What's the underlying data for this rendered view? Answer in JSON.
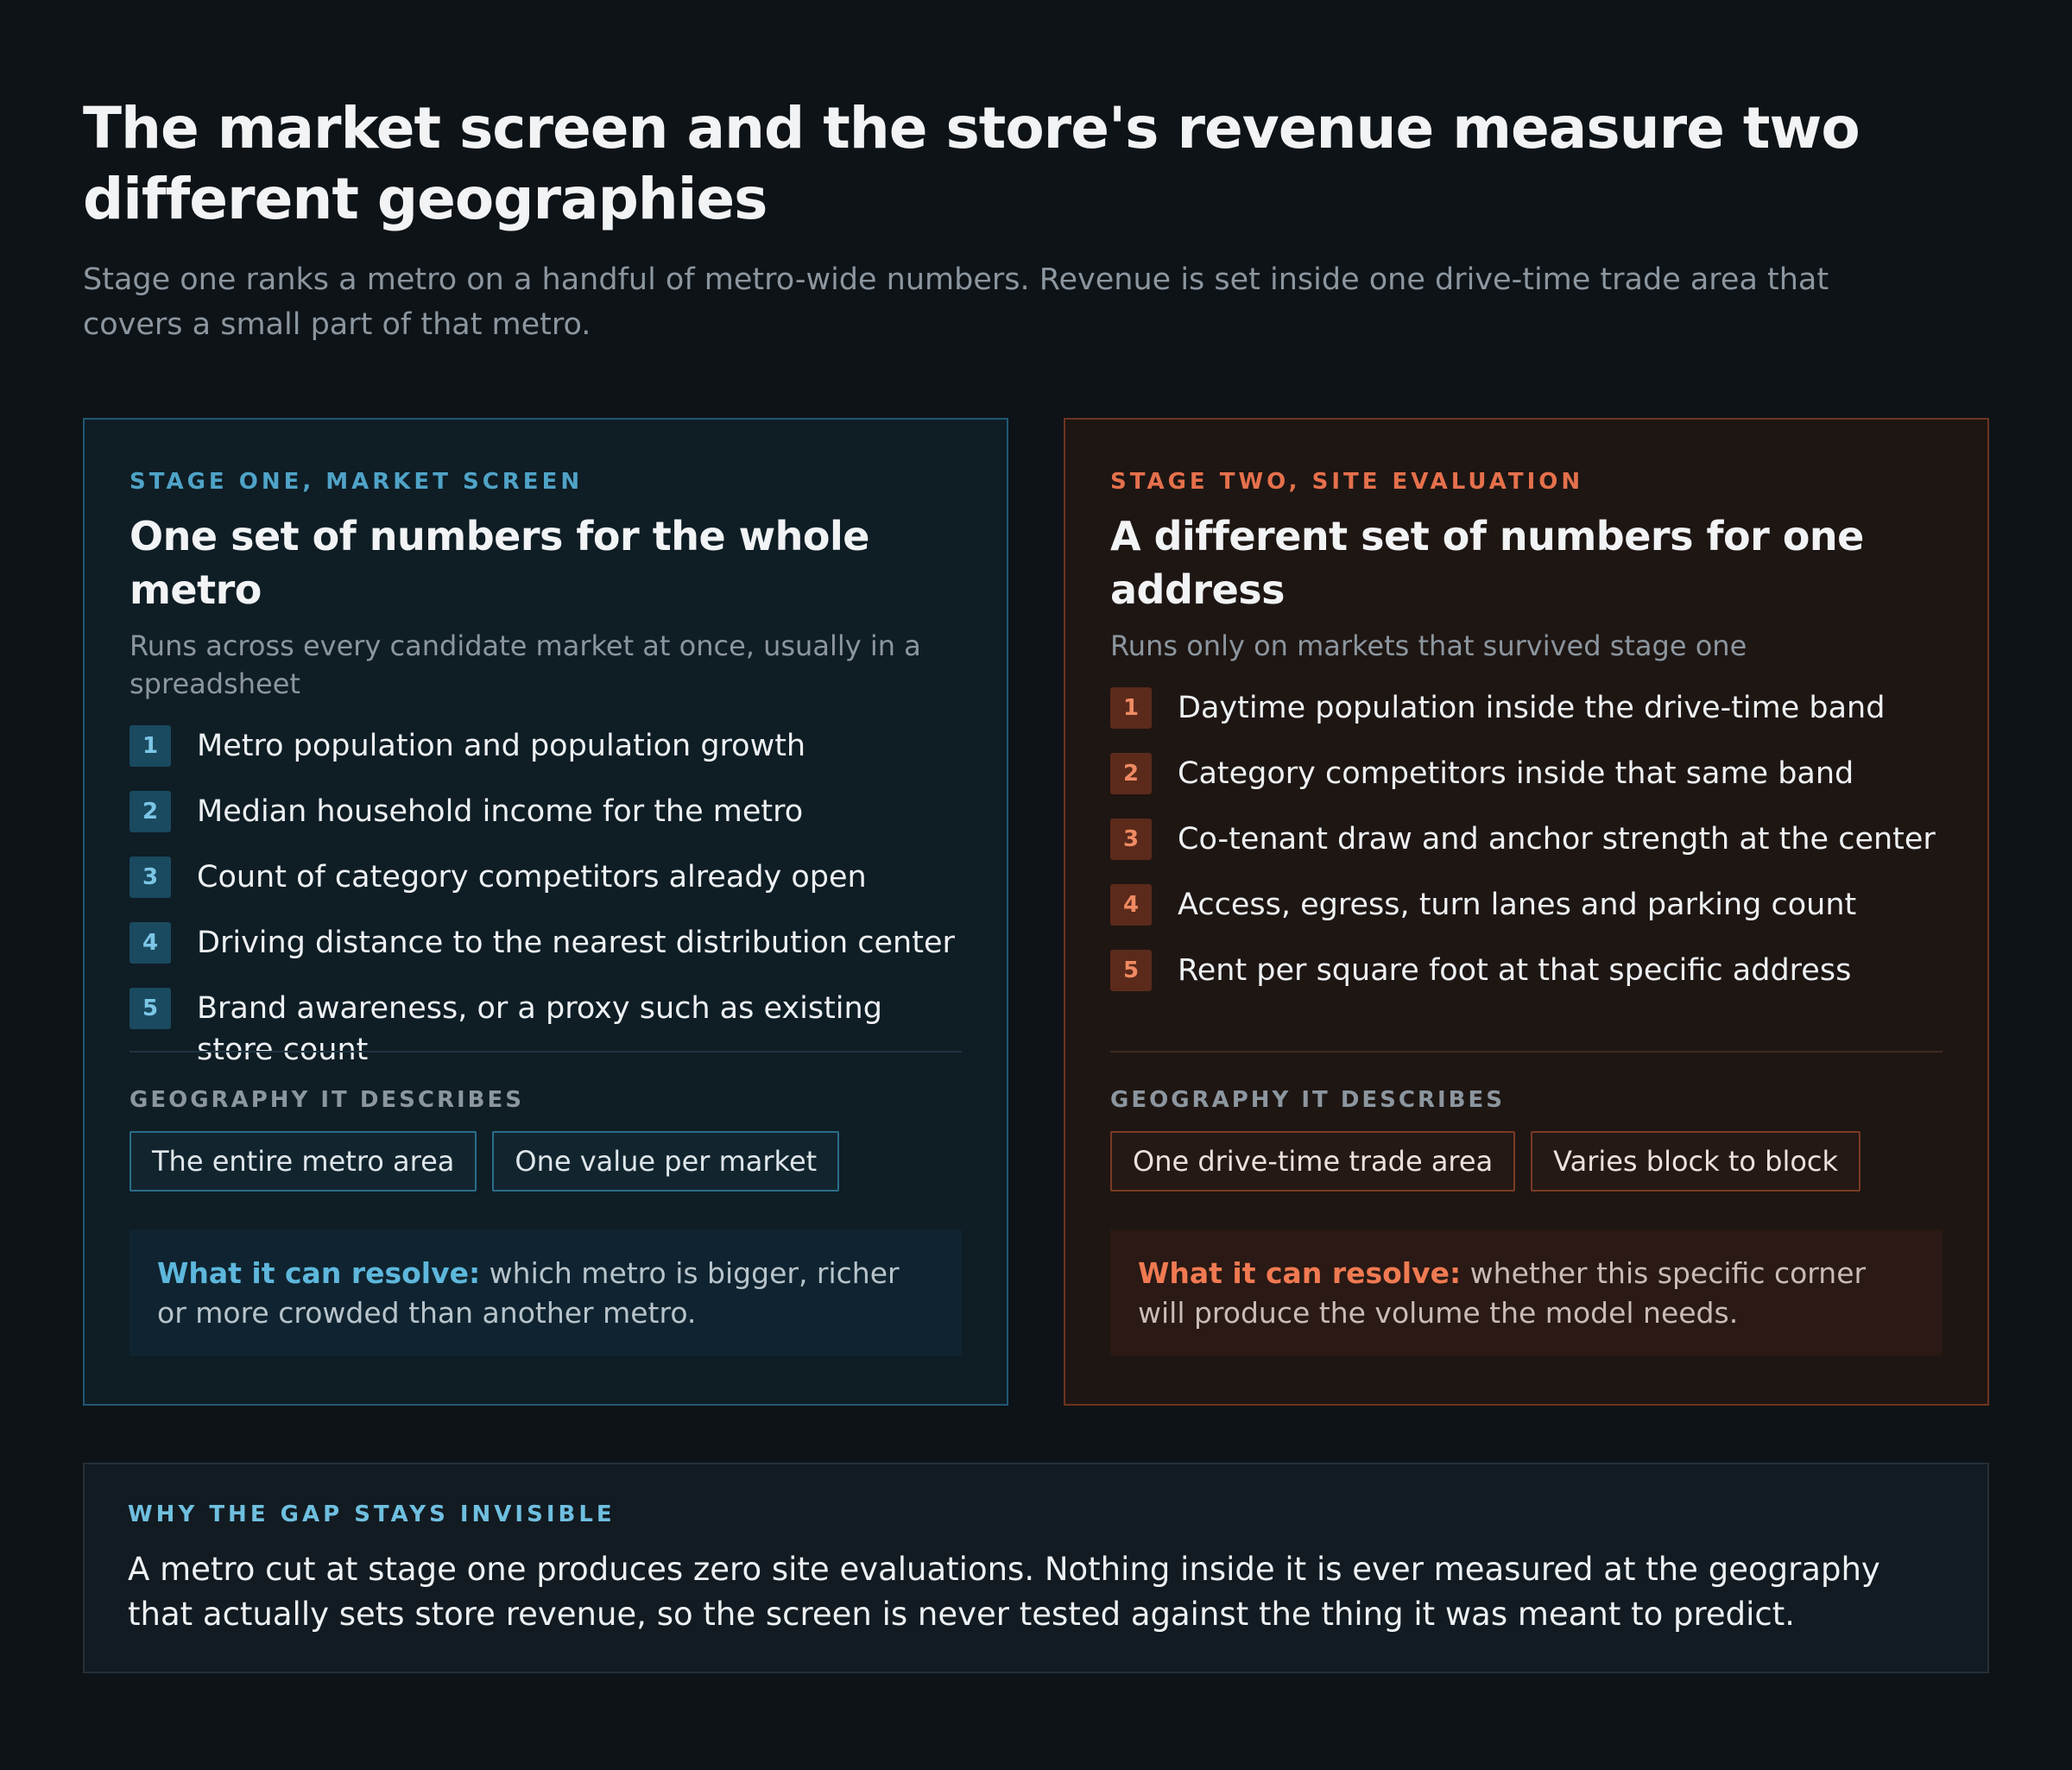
{
  "header": {
    "title": "The market screen and the store's revenue measure two different geographies",
    "subtitle": "Stage one ranks a metro on a handful of metro-wide numbers. Revenue is set inside one drive-time trade area that covers a small part of that metro."
  },
  "stage_one": {
    "eyebrow": "STAGE ONE, MARKET SCREEN",
    "title": "One set of numbers for the whole metro",
    "subtitle": "Runs across every candidate market at once, usually in a spreadsheet",
    "items": [
      {
        "num": "1",
        "text": "Metro population and population growth"
      },
      {
        "num": "2",
        "text": "Median household income for the metro"
      },
      {
        "num": "3",
        "text": "Count of category competitors already open"
      },
      {
        "num": "4",
        "text": "Driving distance to the nearest distribution center"
      },
      {
        "num": "5",
        "text": "Brand awareness, or a proxy such as existing store count"
      }
    ],
    "geo_label": "GEOGRAPHY IT DESCRIBES",
    "chips": [
      "The entire metro area",
      "One value per market"
    ],
    "resolve_lead": "What it can resolve:",
    "resolve_text": " which metro is bigger, richer or more crowded than another metro.",
    "accent_color": "#4fa3c7"
  },
  "stage_two": {
    "eyebrow": "STAGE TWO, SITE EVALUATION",
    "title": "A different set of numbers for one address",
    "subtitle": "Runs only on markets that survived stage one",
    "items": [
      {
        "num": "1",
        "text": "Daytime population inside the drive-time band"
      },
      {
        "num": "2",
        "text": "Category competitors inside that same band"
      },
      {
        "num": "3",
        "text": "Co-tenant draw and anchor strength at the center"
      },
      {
        "num": "4",
        "text": "Access, egress, turn lanes and parking count"
      },
      {
        "num": "5",
        "text": "Rent per square foot at that specific address"
      }
    ],
    "geo_label": "GEOGRAPHY IT DESCRIBES",
    "chips": [
      "One drive-time trade area",
      "Varies block to block"
    ],
    "resolve_lead": "What it can resolve:",
    "resolve_text": " whether this specific corner will produce the volume the model needs.",
    "accent_color": "#e5704c"
  },
  "why_gap": {
    "eyebrow": "WHY THE GAP STAYS INVISIBLE",
    "text": "A metro cut at stage one produces zero site evaluations. Nothing inside it is ever measured at the geography that actually sets store revenue, so the screen is never tested against the thing it was meant to predict."
  }
}
